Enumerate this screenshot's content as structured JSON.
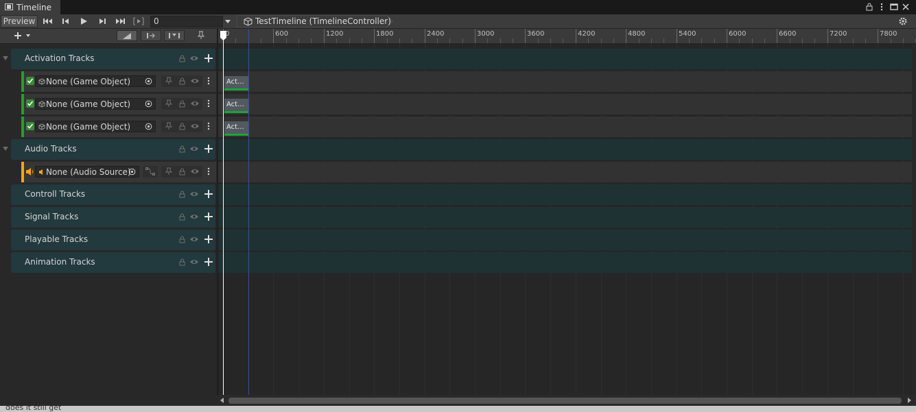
{
  "window": {
    "tab_label": "Timeline"
  },
  "toolbar": {
    "preview_label": "Preview",
    "time_value": "0",
    "breadcrumb": "TestTimeline (TimelineController)"
  },
  "ruler": {
    "labels": [
      "0",
      "600",
      "1200",
      "1800",
      "2400",
      "3000",
      "3600",
      "4200",
      "4800",
      "5400",
      "6000",
      "6600",
      "7200",
      "7800"
    ]
  },
  "groups": [
    {
      "label": "Activation Tracks",
      "expanded": true
    },
    {
      "label": "Audio Tracks",
      "expanded": true
    },
    {
      "label": "Controll Tracks",
      "expanded": false
    },
    {
      "label": "Signal Tracks",
      "expanded": false
    },
    {
      "label": "Playable Tracks",
      "expanded": false
    },
    {
      "label": "Animation Tracks",
      "expanded": false
    }
  ],
  "activation_tracks": [
    {
      "binding": "None (Game Object)",
      "clip": "Act..."
    },
    {
      "binding": "None (Game Object)",
      "clip": "Act..."
    },
    {
      "binding": "None (Game Object)",
      "clip": "Act..."
    }
  ],
  "audio_track": {
    "binding": "None (Audio Source)"
  },
  "colors": {
    "activation_accent": "#21a12d",
    "audio_accent": "#f5a612",
    "clip_underline": "#1ba537",
    "group_bg": "#22393d",
    "playhead": "#ffffff",
    "end_marker": "#3a4d9a"
  },
  "footer_text": "does it still get"
}
